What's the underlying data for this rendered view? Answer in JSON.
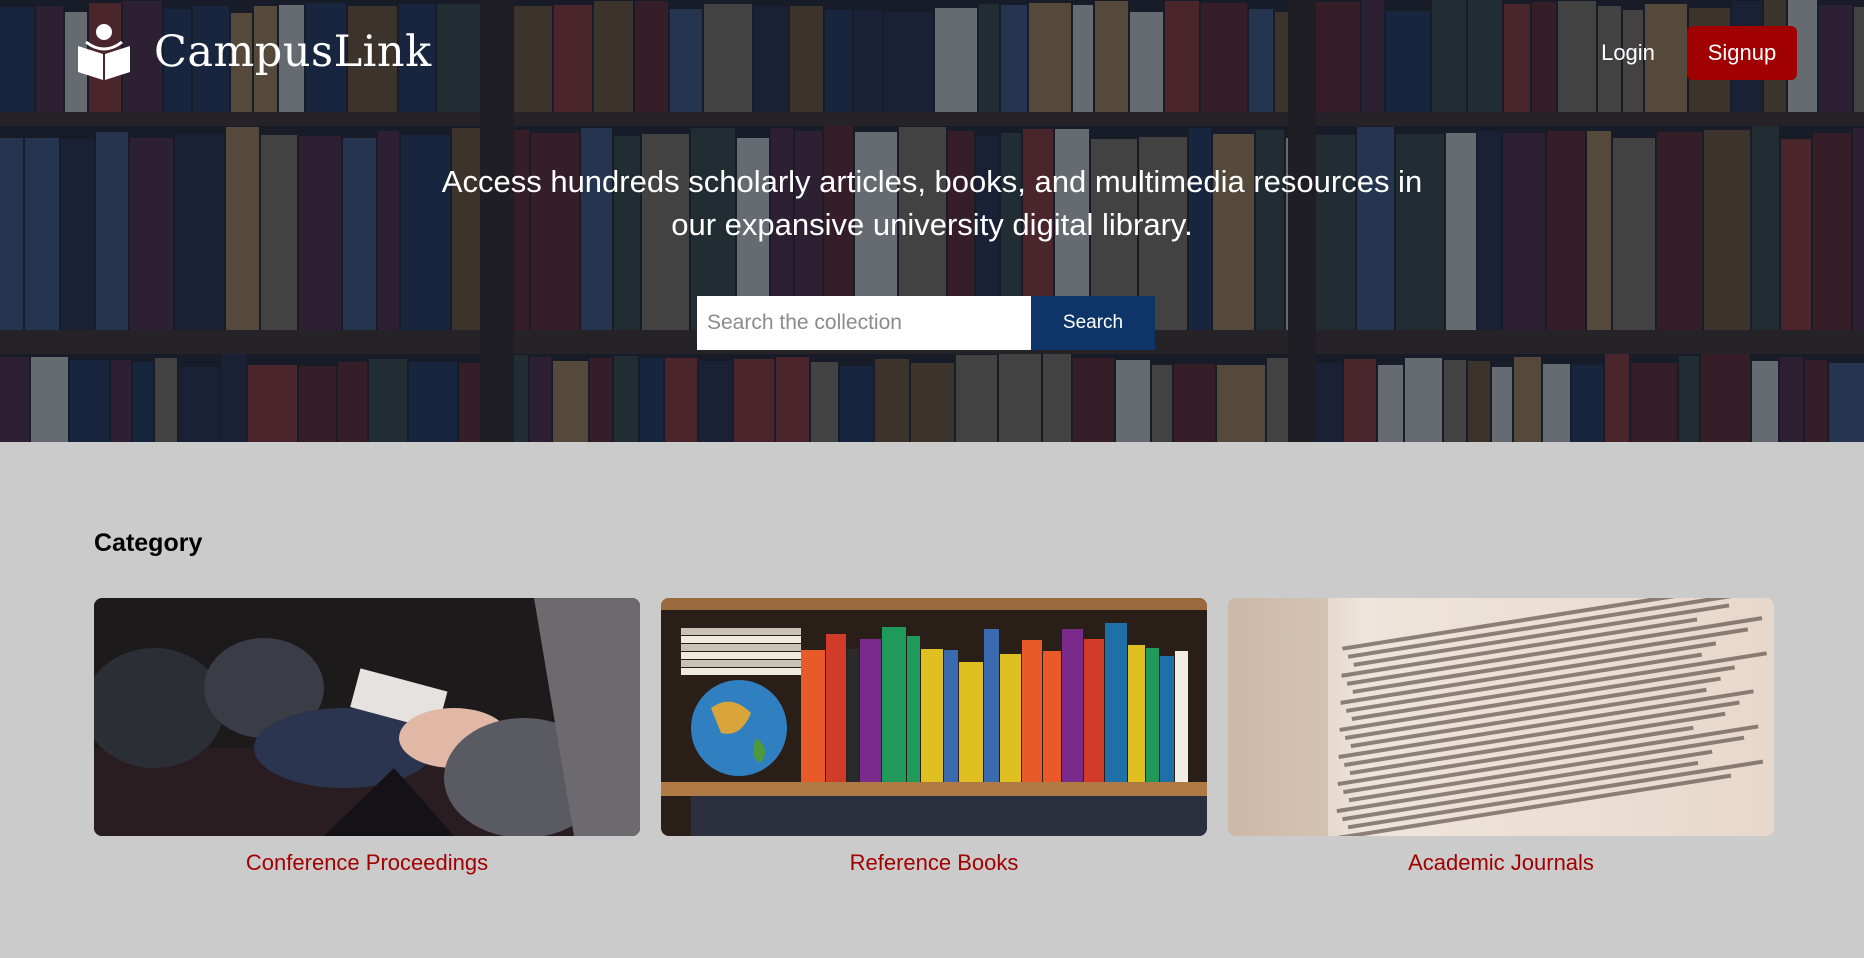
{
  "brand": {
    "name": "CampusLink",
    "logo_icon": "book-reader-icon"
  },
  "nav": {
    "login_label": "Login",
    "signup_label": "Signup"
  },
  "hero": {
    "headline": "Access hundreds scholarly articles, books, and multimedia resources in our expansive university digital library.",
    "search_placeholder": "Search the collection",
    "search_value": "",
    "search_button": "Search"
  },
  "categories": {
    "title": "Category",
    "items": [
      {
        "label": "Conference Proceedings",
        "image": "conference-attendees-taking-notes"
      },
      {
        "label": "Reference Books",
        "image": "bookshelf-with-globe"
      },
      {
        "label": "Academic Journals",
        "image": "open-dictionary-page"
      }
    ]
  },
  "colors": {
    "accent_red": "#a10000",
    "search_button_blue": "#0e3567",
    "page_background": "#cbcbcb"
  }
}
